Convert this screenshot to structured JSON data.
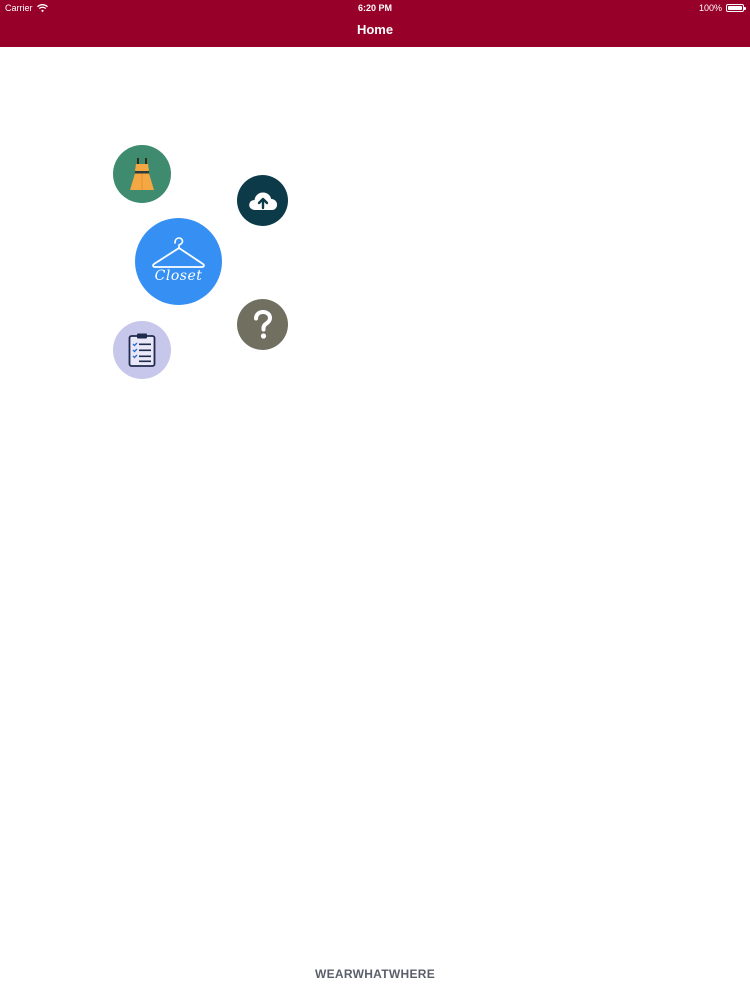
{
  "status_bar": {
    "carrier": "Carrier",
    "time": "6:20 PM",
    "battery": "100%",
    "battery_level": 1.0
  },
  "nav": {
    "title": "Home"
  },
  "menu": {
    "closet_label": "Closet",
    "outfit_icon": "dress-icon",
    "upload_icon": "cloud-upload-icon",
    "help_icon": "question-mark-icon",
    "list_icon": "clipboard-checklist-icon",
    "closet_icon": "hanger-icon"
  },
  "colors": {
    "nav_bar": "#970028",
    "outfit": "#3e8b70",
    "upload": "#0d3a48",
    "closet": "#3690f3",
    "help": "#717060",
    "list": "#c7c6eb",
    "footer_text": "#5a5f6b"
  },
  "footer": {
    "brand": "WEARWHATWHERE"
  }
}
